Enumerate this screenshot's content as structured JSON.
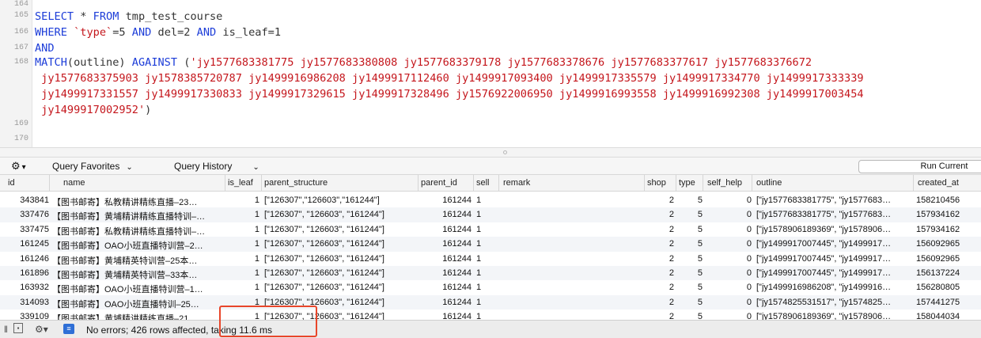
{
  "editor": {
    "line_numbers": [
      "164",
      "165",
      "166",
      "167",
      "168",
      "169",
      "170"
    ],
    "lines": [
      [],
      [
        {
          "t": "SELECT",
          "c": "kw"
        },
        {
          "t": " * ",
          "c": "id"
        },
        {
          "t": "FROM",
          "c": "kw"
        },
        {
          "t": " tmp_test_course",
          "c": "id"
        }
      ],
      [
        {
          "t": "WHERE",
          "c": "kw"
        },
        {
          "t": " `type`",
          "c": "str"
        },
        {
          "t": "=5 ",
          "c": "id"
        },
        {
          "t": "AND",
          "c": "kw"
        },
        {
          "t": " del=2 ",
          "c": "id"
        },
        {
          "t": "AND",
          "c": "kw"
        },
        {
          "t": " is_leaf=1",
          "c": "id"
        }
      ],
      [
        {
          "t": "AND",
          "c": "kw"
        }
      ],
      [
        {
          "t": "MATCH",
          "c": "kw"
        },
        {
          "t": "(outline) ",
          "c": "id"
        },
        {
          "t": "AGAINST",
          "c": "kw"
        },
        {
          "t": " (",
          "c": "id"
        },
        {
          "t": "'jy1577683381775 jy1577683380808 jy1577683379178 jy1577683378676 jy1577683377617 jy1577683376672",
          "c": "str"
        }
      ],
      [
        {
          "t": " jy1577683375903 jy1578385720787 jy1499916986208 jy1499917112460 jy1499917093400 jy1499917335579 jy1499917334770 jy1499917333339",
          "c": "str"
        }
      ],
      [
        {
          "t": " jy1499917331557 jy1499917330833 jy1499917329615 jy1499917328496 jy1576922006950 jy1499916993558 jy1499916992308 jy1499917003454",
          "c": "str"
        }
      ],
      [
        {
          "t": " jy1499917002952'",
          "c": "str"
        },
        {
          "t": ")",
          "c": "id"
        }
      ],
      [],
      []
    ]
  },
  "toolbar": {
    "gear_glyph": "⚙",
    "favorites_label": "Query Favorites",
    "history_label": "Query History",
    "run_label": "Run Current"
  },
  "grid": {
    "columns": [
      "id",
      "name",
      "is_leaf",
      "parent_structure",
      "parent_id",
      "sell",
      "remark",
      "shop",
      "type",
      "self_help",
      "outline",
      "created_at"
    ],
    "rows": [
      [
        "343841",
        "【图书邮寄】私教精讲精练直播–23…",
        "1",
        "[\"126307\",\"126603\",\"161244\"]",
        "161244",
        "1",
        "",
        "2",
        "5",
        "0",
        "[\"jy1577683381775\", \"jy1577683…",
        "158210456"
      ],
      [
        "337476",
        "【图书邮寄】黄埔精讲精练直播特训–…",
        "1",
        "[\"126307\", \"126603\", \"161244\"]",
        "161244",
        "1",
        "",
        "2",
        "5",
        "0",
        "[\"jy1577683381775\", \"jy1577683…",
        "157934162"
      ],
      [
        "337475",
        "【图书邮寄】私教精讲精练直播特训–…",
        "1",
        "[\"126307\", \"126603\", \"161244\"]",
        "161244",
        "1",
        "",
        "2",
        "5",
        "0",
        "[\"jy1578906189369\", \"jy1578906…",
        "157934162"
      ],
      [
        "161245",
        "【图书邮寄】OAO小班直播特训营–2…",
        "1",
        "[\"126307\", \"126603\", \"161244\"]",
        "161244",
        "1",
        "",
        "2",
        "5",
        "0",
        "[\"jy1499917007445\", \"jy1499917…",
        "156092965"
      ],
      [
        "161246",
        "【图书邮寄】黄埔精英特训营–25本…",
        "1",
        "[\"126307\", \"126603\", \"161244\"]",
        "161244",
        "1",
        "",
        "2",
        "5",
        "0",
        "[\"jy1499917007445\", \"jy1499917…",
        "156092965"
      ],
      [
        "161896",
        "【图书邮寄】黄埔精英特训营–33本…",
        "1",
        "[\"126307\", \"126603\", \"161244\"]",
        "161244",
        "1",
        "",
        "2",
        "5",
        "0",
        "[\"jy1499917007445\", \"jy1499917…",
        "156137224"
      ],
      [
        "163932",
        "【图书邮寄】OAO小班直播特训营–1…",
        "1",
        "[\"126307\", \"126603\", \"161244\"]",
        "161244",
        "1",
        "",
        "2",
        "5",
        "0",
        "[\"jy1499916986208\", \"jy1499916…",
        "156280805"
      ],
      [
        "314093",
        "【图书邮寄】OAO小班直播特训–25…",
        "1",
        "[\"126307\", \"126603\", \"161244\"]",
        "161244",
        "1",
        "",
        "2",
        "5",
        "0",
        "[\"jy1574825531517\", \"jy1574825…",
        "157441275"
      ],
      [
        "339109",
        "【图书邮寄】黄埔精讲精练直播–21…",
        "1",
        "[\"126307\", \"126603\", \"161244\"]",
        "161244",
        "1",
        "",
        "2",
        "5",
        "0",
        "[\"jy1578906189369\", \"jy1578906…",
        "158044034"
      ]
    ]
  },
  "status": {
    "text": "No errors; 426 rows affected, taking 11.6 ms",
    "highlight_color": "#e8462a"
  }
}
